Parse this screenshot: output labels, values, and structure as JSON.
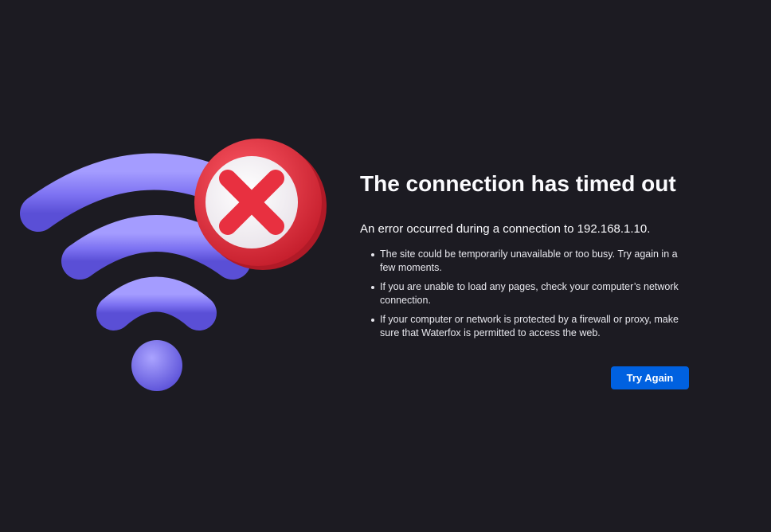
{
  "page": {
    "background": "#1c1b22"
  },
  "illustration": {
    "icon": "wifi-error-icon",
    "wifi_color": "#7b6ff0",
    "error_color": "#e8303c"
  },
  "error": {
    "title": "The connection has timed out",
    "intro": "An error occurred during a connection to 192.168.1.10.",
    "reasons": [
      {
        "text": "The site could be temporarily unavailable or too busy. Try again in a few moments."
      },
      {
        "text": "If you are unable to load any pages, check your computer’s network connection."
      },
      {
        "text": "If your computer or network is protected by a firewall or proxy, make sure that Waterfox is permitted to access the web."
      }
    ]
  },
  "actions": {
    "try_again_label": "Try Again",
    "button_color": "#0061e0"
  }
}
